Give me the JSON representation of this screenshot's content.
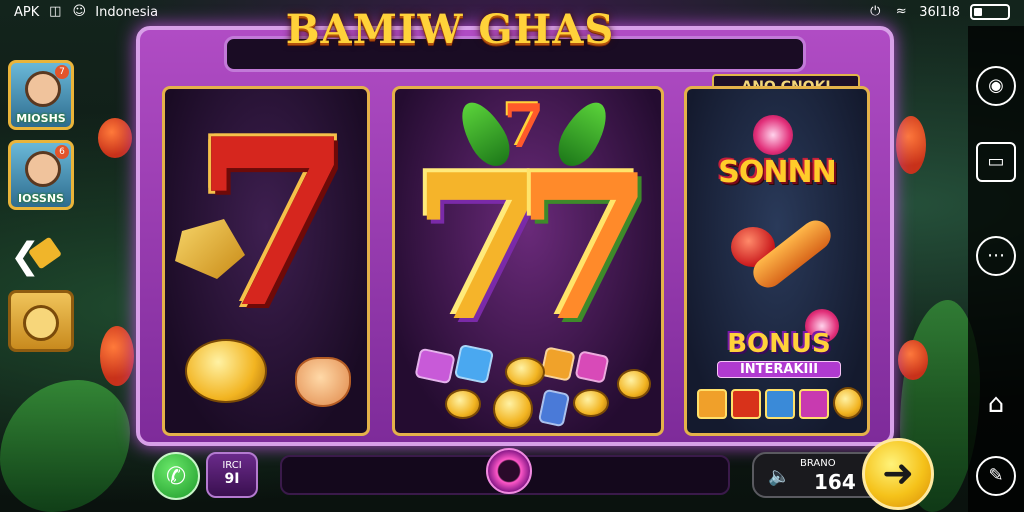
{
  "status_bar": {
    "app": "APK",
    "region": "Indonesia",
    "battery_text": "36I1I8"
  },
  "game": {
    "title": "BAMIW GHAS",
    "badge": "ANO CNOKI",
    "symbols": {
      "reel3_top": "SONNN",
      "reel3_bonus": "BONUS",
      "reel3_bonus_sub": "INTERAKIII"
    },
    "left_tiles": [
      "MIOSHS",
      "IOSSNS"
    ],
    "bet_box": {
      "line1": "IRCI",
      "line2": "9I"
    },
    "balance": {
      "label": "BRANO",
      "value": "164"
    }
  }
}
